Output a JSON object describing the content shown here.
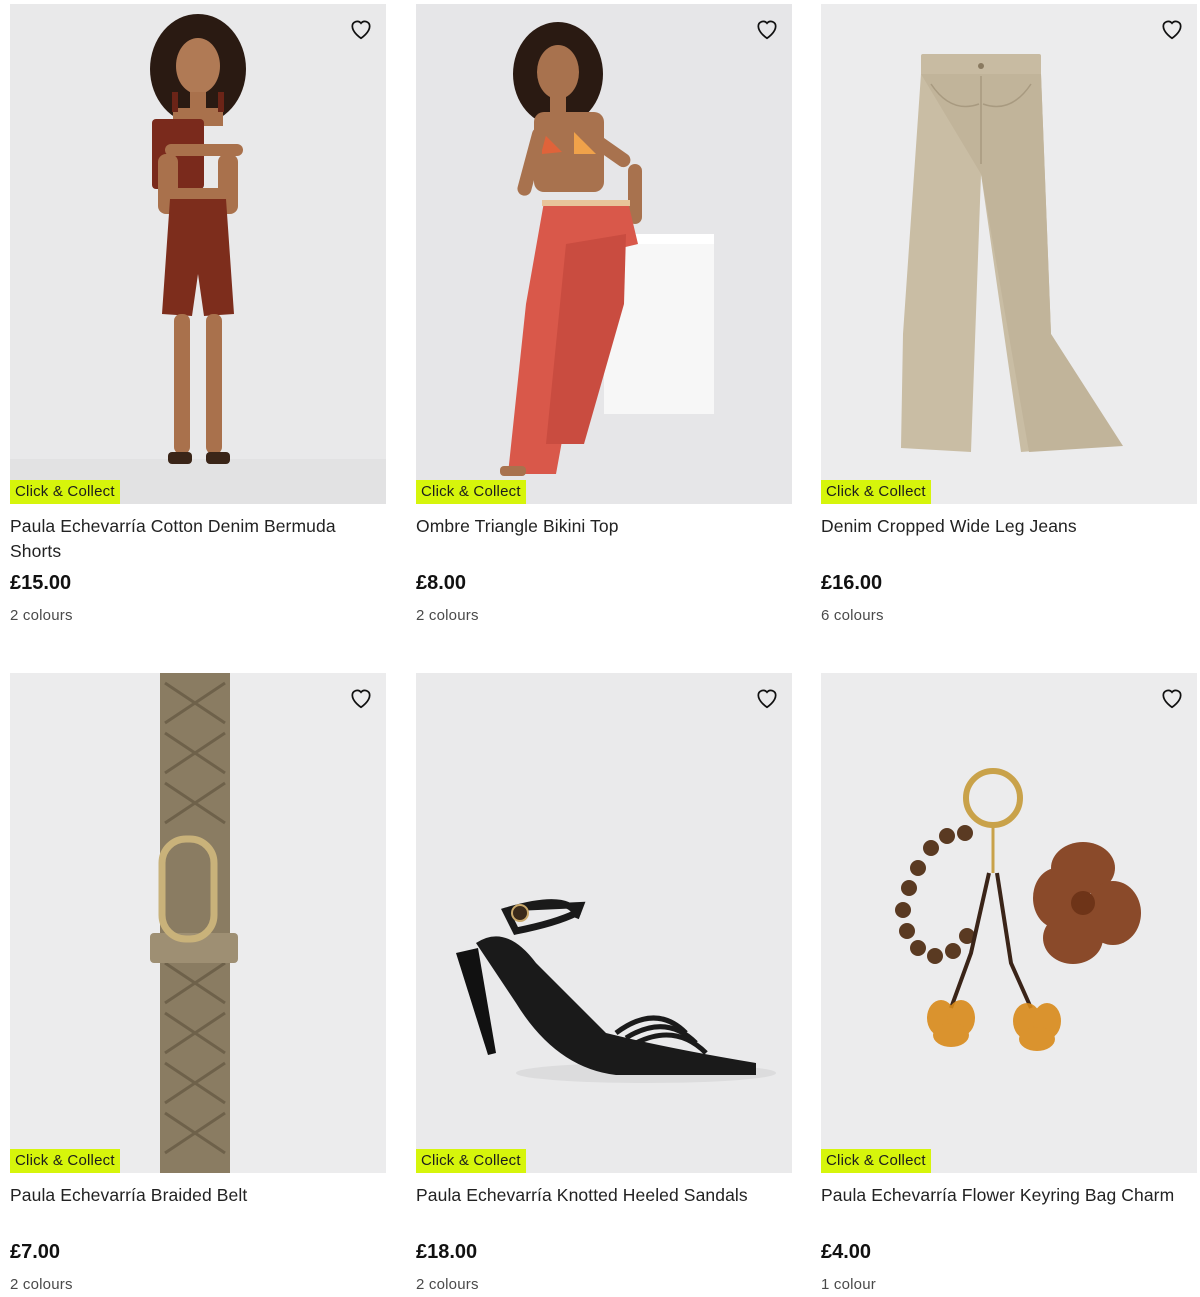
{
  "badge_label": "Click & Collect",
  "colors": {
    "badge": "#d6f50b",
    "image_bg": "#eeeeef"
  },
  "products": [
    {
      "title": "Paula Echevarría Cotton Denim Bermuda Shorts",
      "price": "£15.00",
      "colours": "2 colours",
      "image": "model-brown-top-shorts",
      "icon": "heart-outline"
    },
    {
      "title": "Ombre Triangle Bikini Top",
      "price": "£8.00",
      "colours": "2 colours",
      "image": "model-bikini-red-trousers",
      "icon": "heart-outline"
    },
    {
      "title": "Denim Cropped Wide Leg Jeans",
      "price": "£16.00",
      "colours": "6 colours",
      "image": "beige-wide-leg-jeans",
      "icon": "heart-outline"
    },
    {
      "title": "Paula Echevarría Braided Belt",
      "price": "£7.00",
      "colours": "2 colours",
      "image": "braided-belt",
      "icon": "heart-outline"
    },
    {
      "title": "Paula Echevarría Knotted Heeled Sandals",
      "price": "£18.00",
      "colours": "2 colours",
      "image": "black-heeled-sandal",
      "icon": "heart-outline"
    },
    {
      "title": "Paula Echevarría Flower Keyring Bag Charm",
      "price": "£4.00",
      "colours": "1 colour",
      "image": "flower-keyring-charm",
      "icon": "heart-outline"
    }
  ]
}
